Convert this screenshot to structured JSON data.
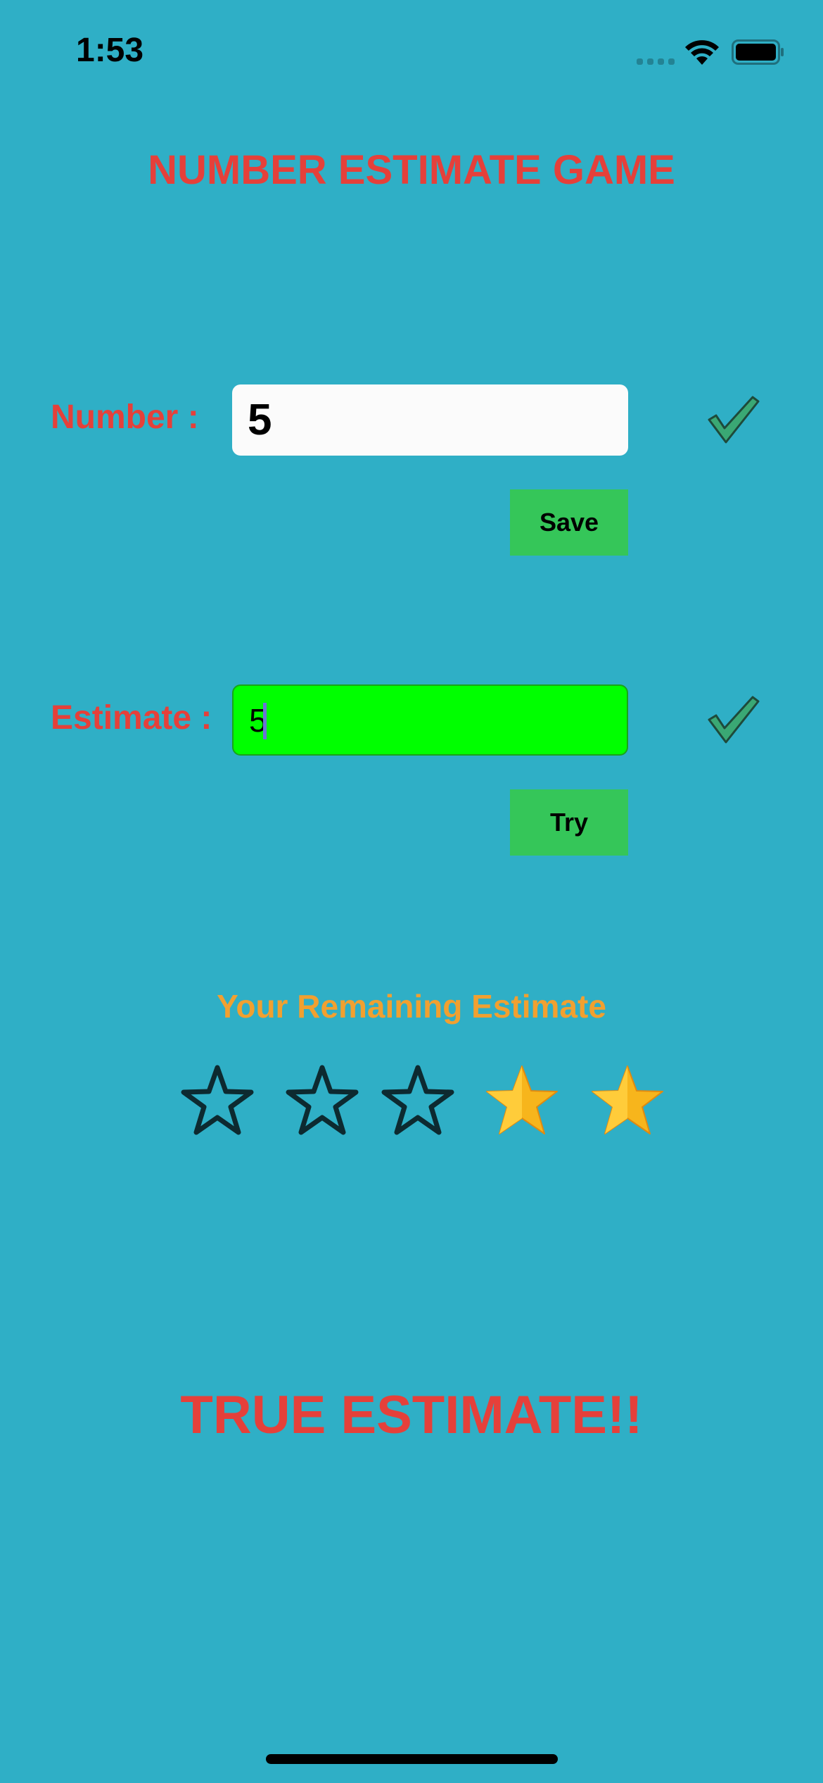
{
  "status_bar": {
    "time": "1:53",
    "icons": [
      "signal-icon",
      "wifi-icon",
      "battery-icon"
    ]
  },
  "title": "NUMBER ESTIMATE GAME",
  "number_section": {
    "label": "Number :",
    "value": "5",
    "confirmed_icon": "checkmark-icon",
    "save_label": "Save"
  },
  "estimate_section": {
    "label": "Estimate :",
    "value": "5",
    "confirmed_icon": "checkmark-icon",
    "try_label": "Try"
  },
  "remaining": {
    "label": "Your Remaining Estimate",
    "stars_total": 5,
    "stars_filled": 2,
    "stars": [
      "empty",
      "empty",
      "empty",
      "filled",
      "filled"
    ]
  },
  "result_text": "TRUE ESTIMATE!!",
  "colors": {
    "background": "#2fafc6",
    "title": "#e5403a",
    "button": "#35c659",
    "estimate_field": "#00ff00",
    "remaining_label": "#f1a030",
    "star_filled": "#f7b51c"
  }
}
